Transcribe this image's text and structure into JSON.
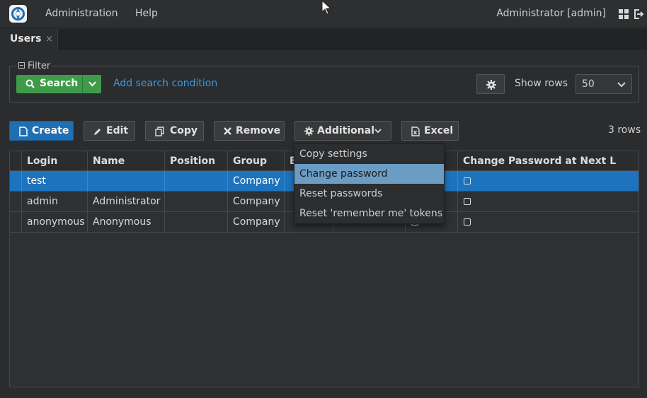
{
  "topbar": {
    "menu": [
      "Administration",
      "Help"
    ],
    "user": "Administrator [admin]",
    "icons": [
      "app-logo-icon",
      "grid-icon",
      "logout-icon"
    ]
  },
  "tabs": [
    {
      "label": "Users",
      "close": "×"
    }
  ],
  "filter": {
    "legend": "Filter",
    "search_label": "Search",
    "add_condition": "Add search condition",
    "show_rows_label": "Show rows",
    "show_rows_value": "50"
  },
  "toolbar": {
    "create": "Create",
    "edit": "Edit",
    "copy": "Copy",
    "remove": "Remove",
    "additional": "Additional",
    "excel": "Excel",
    "rows_count": "3 rows"
  },
  "dropdown": {
    "items": [
      "Copy settings",
      "Change password",
      "Reset passwords",
      "Reset 'remember me' tokens"
    ],
    "highlighted": "Change password"
  },
  "table": {
    "columns": [
      "Login",
      "Name",
      "Position",
      "Group",
      "E",
      "",
      "Change Password at Next L"
    ],
    "rows": [
      {
        "login": "test",
        "name": "",
        "position": "",
        "group": "Company",
        "selected": true
      },
      {
        "login": "admin",
        "name": "Administrator",
        "position": "",
        "group": "Company",
        "selected": false
      },
      {
        "login": "anonymous",
        "name": "Anonymous",
        "position": "",
        "group": "Company",
        "selected": false
      }
    ]
  },
  "colors": {
    "accent_blue": "#1f6fb2",
    "search_green": "#3f9b4a",
    "link_blue": "#3d9ae0",
    "menu_hover": "#6b9cc4"
  }
}
